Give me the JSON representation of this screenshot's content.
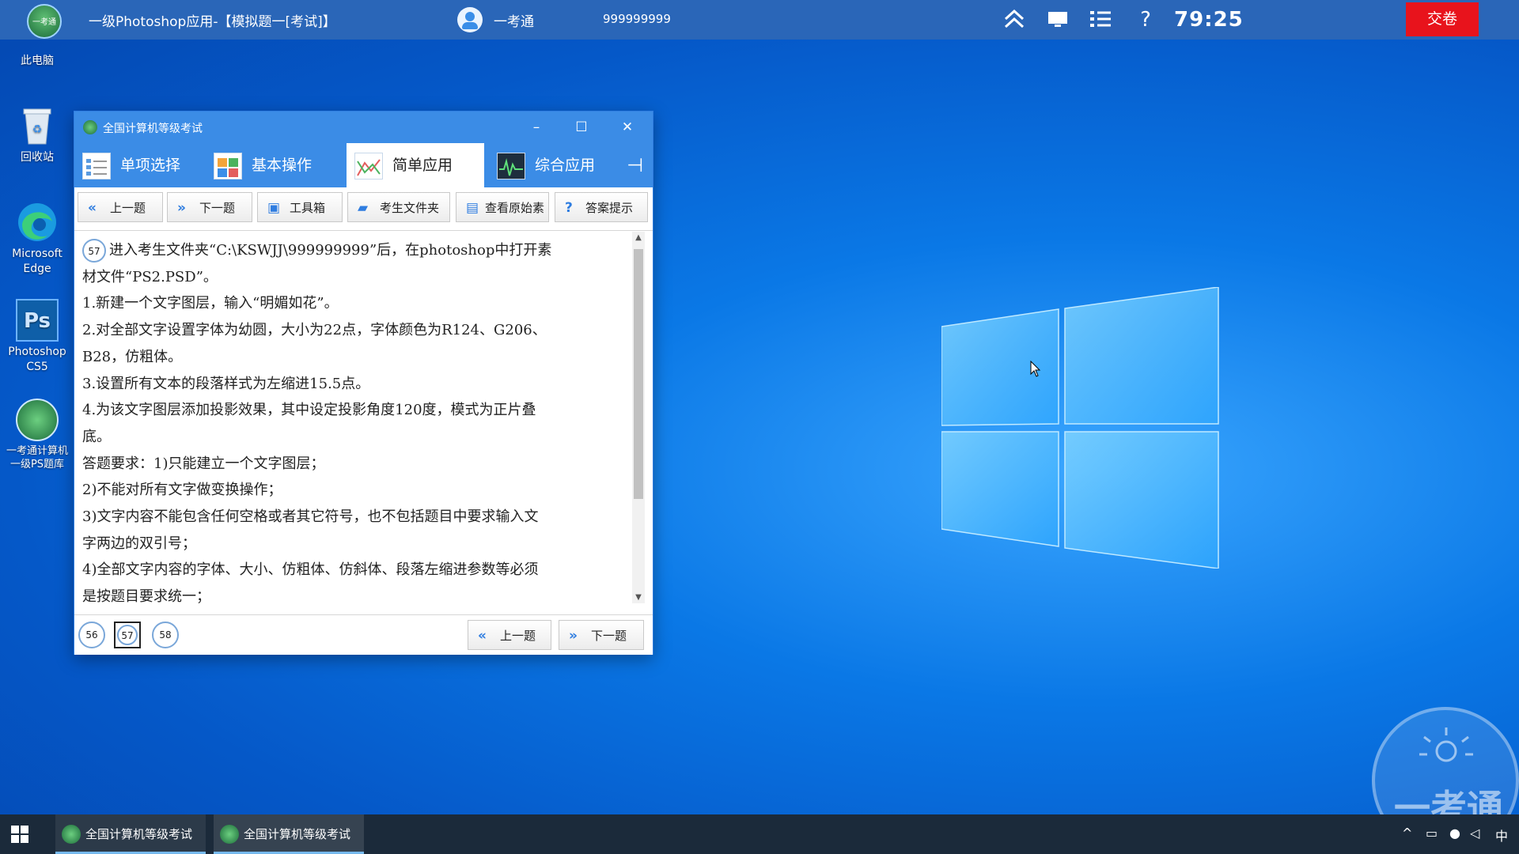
{
  "topbar": {
    "logo_text": "一考通",
    "title": "一级Photoshop应用-【模拟题一[考试]】",
    "username": "一考通",
    "exam_id": "999999999",
    "timer": "79:25",
    "submit_label": "交卷"
  },
  "desktop": {
    "icons": [
      {
        "label": "此电脑"
      },
      {
        "label": "回收站"
      },
      {
        "label": "Microsoft Edge"
      },
      {
        "label": "Photoshop CS5"
      },
      {
        "label": "一考通计算机一级PS题库"
      }
    ],
    "watermark_text": "一考通"
  },
  "window": {
    "title": "全国计算机等级考试",
    "tabs": [
      {
        "label": "单项选择"
      },
      {
        "label": "基本操作"
      },
      {
        "label": "简单应用"
      },
      {
        "label": "综合应用"
      }
    ],
    "toolbar": {
      "prev_label": "上一题",
      "next_label": "下一题",
      "toolbox_label": "工具箱",
      "folder_label": "考生文件夹",
      "source_label": "查看原始素",
      "hint_label": "答案提示"
    },
    "question": {
      "number": "57",
      "lines": [
        "进入考生文件夹“C:\\KSWJJ\\999999999”后，在photoshop中打开素",
        "材文件“PS2.PSD”。",
        "1.新建一个文字图层，输入“明媚如花”。",
        "2.对全部文字设置字体为幼圆，大小为22点，字体颜色为R124、G206、",
        "B28，仿粗体。",
        "3.设置所有文本的段落样式为左缩进15.5点。",
        "4.为该文字图层添加投影效果，其中设定投影角度120度，模式为正片叠",
        "底。",
        "答题要求：1)只能建立一个文字图层；",
        "2)不能对所有文字做变换操作；",
        "3)文字内容不能包含任何空格或者其它符号，也不包括题目中要求输入文",
        "字两边的双引号；",
        "4)全部文字内容的字体、大小、仿粗体、仿斜体、段落左缩进参数等必须",
        "是按题目要求统一；"
      ]
    },
    "pager": {
      "pages": [
        "56",
        "57",
        "58"
      ],
      "prev_label": "上一题",
      "next_label": "下一题"
    }
  },
  "taskbar": {
    "items": [
      {
        "label": "全国计算机等级考试"
      },
      {
        "label": "全国计算机等级考试"
      }
    ],
    "ime": "中"
  },
  "colors": {
    "accent": "#3b8ce6",
    "topbar": "#2a66b8",
    "submit": "#e8131c",
    "taskbar": "#1b2a3a"
  }
}
